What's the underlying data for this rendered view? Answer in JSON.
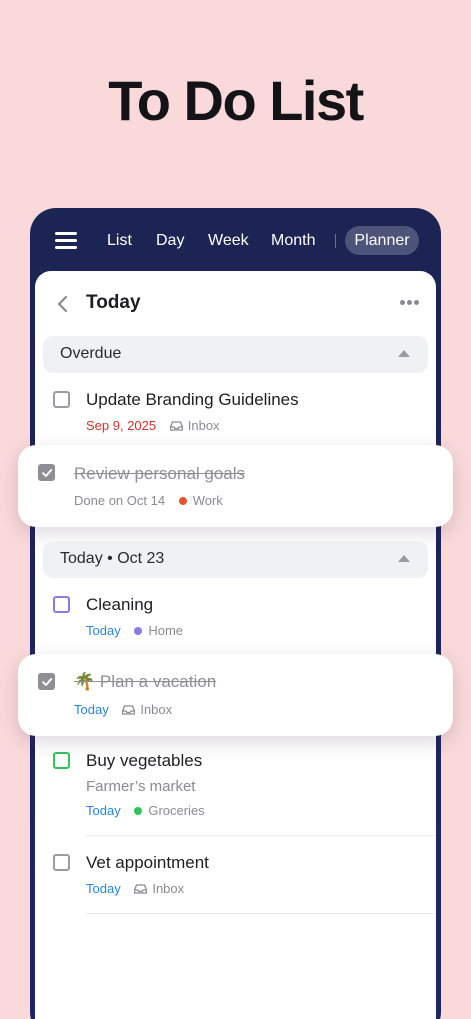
{
  "hero": {
    "title": "To Do List"
  },
  "nav": {
    "tabs": [
      "List",
      "Day",
      "Week",
      "Month"
    ],
    "active": "Planner"
  },
  "sheet": {
    "title": "Today"
  },
  "sections": {
    "overdue": "Overdue",
    "today": "Today • Oct 23"
  },
  "tasks": [
    {
      "title": "Update Branding Guidelines",
      "date": "Sep 9, 2025",
      "list": "Inbox",
      "done": false
    },
    {
      "title": "Review personal goals",
      "date": "Done on Oct 14",
      "list": "Work",
      "done": true
    },
    {
      "title": "Cleaning",
      "date": "Today",
      "list": "Home",
      "done": false
    },
    {
      "title": "Plan a vacation",
      "emoji": "🌴",
      "date": "Today",
      "list": "Inbox",
      "done": true
    },
    {
      "title": "Buy vegetables",
      "note": "Farmer’s market",
      "date": "Today",
      "list": "Groceries",
      "done": false
    },
    {
      "title": "Vet appointment",
      "date": "Today",
      "list": "Inbox",
      "done": false
    }
  ],
  "colors": {
    "work": "#e8542a",
    "home": "#8a7be3",
    "groceries": "#2ec45a",
    "overdue_date": "#d0312d",
    "today_date": "#2a85d6",
    "cleaning_checkbox": "#8a7be3",
    "groceries_checkbox": "#2ec45a"
  }
}
